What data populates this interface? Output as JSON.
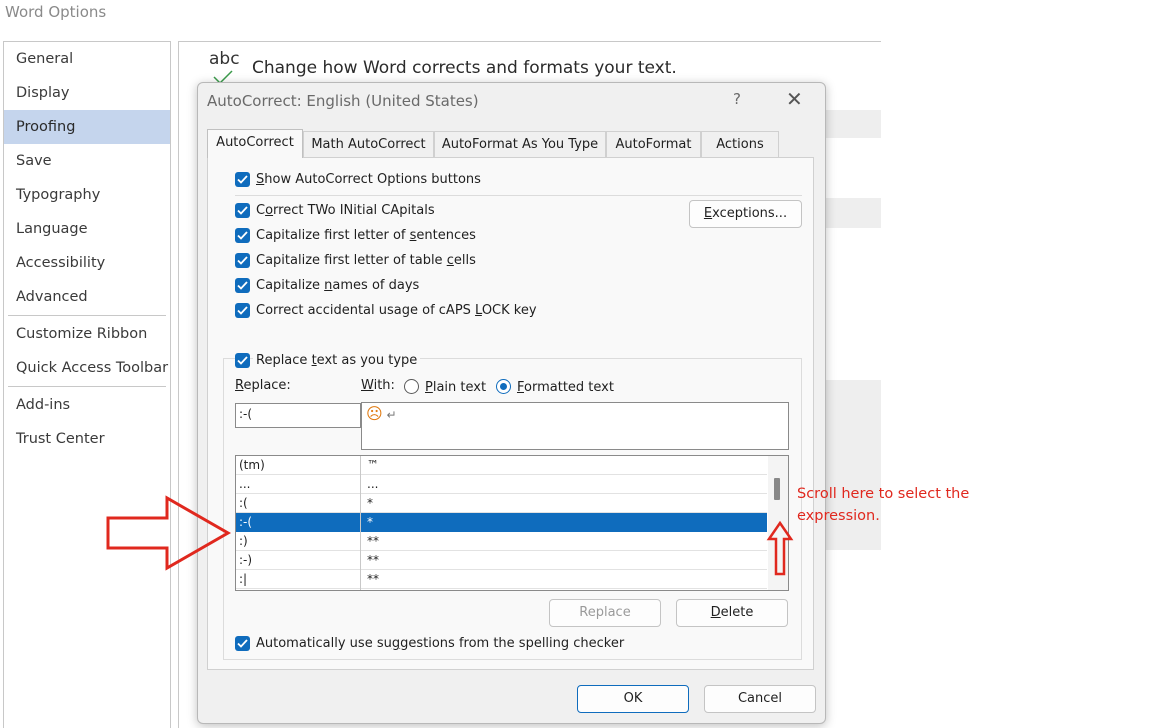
{
  "window": {
    "title": "Word Options"
  },
  "sidebar": {
    "items": [
      {
        "label": "General"
      },
      {
        "label": "Display"
      },
      {
        "label": "Proofing",
        "selected": true
      },
      {
        "label": "Save"
      },
      {
        "label": "Typography"
      },
      {
        "label": "Language"
      },
      {
        "label": "Accessibility"
      },
      {
        "label": "Advanced"
      },
      {
        "label": "Customize Ribbon"
      },
      {
        "label": "Quick Access Toolbar"
      },
      {
        "label": "Add-ins"
      },
      {
        "label": "Trust Center"
      }
    ]
  },
  "main": {
    "icon_text": "abc",
    "heading": "Change how Word corrects and formats your text."
  },
  "dialog": {
    "title": "AutoCorrect: English (United States)",
    "help": "?",
    "close": "✕",
    "tabs": [
      {
        "label": "AutoCorrect",
        "active": true
      },
      {
        "label": "Math AutoCorrect"
      },
      {
        "label": "AutoFormat As You Type"
      },
      {
        "label": "AutoFormat"
      },
      {
        "label": "Actions"
      }
    ],
    "show_options": {
      "pre": "",
      "ul": "S",
      "post": "how AutoCorrect Options buttons",
      "checked": true
    },
    "options": [
      {
        "pre": "C",
        "ul": "o",
        "post": "rrect TWo INitial CApitals",
        "checked": true
      },
      {
        "pre": "Capitalize first letter of ",
        "ul": "s",
        "post": "entences",
        "checked": true
      },
      {
        "pre": "Capitalize first letter of table ",
        "ul": "c",
        "post": "ells",
        "checked": true
      },
      {
        "pre": "Capitalize ",
        "ul": "n",
        "post": "ames of days",
        "checked": true
      },
      {
        "pre": "Correct accidental usage of cAPS ",
        "ul": "L",
        "post": "OCK key",
        "checked": true
      }
    ],
    "exceptions_button": {
      "pre": "",
      "ul": "E",
      "post": "xceptions..."
    },
    "replace_as_you_type": {
      "pre": "Replace ",
      "ul": "t",
      "post": "ext as you type",
      "checked": true
    },
    "replace_label": {
      "pre": "",
      "ul": "R",
      "post": "eplace:"
    },
    "with_label": {
      "pre": "",
      "ul": "W",
      "post": "ith:"
    },
    "radio_plain": {
      "pre": "",
      "ul": "P",
      "post": "lain text",
      "selected": false
    },
    "radio_formatted": {
      "pre": "",
      "ul": "F",
      "post": "ormatted text",
      "selected": true
    },
    "replace_value": ":-(",
    "with_value": "☹",
    "with_return_mark": "↵",
    "entries": [
      {
        "replace": "(tm)",
        "with": "™"
      },
      {
        "replace": "...",
        "with": "..."
      },
      {
        "replace": ":(",
        "with": "*"
      },
      {
        "replace": ":-(",
        "with": "*",
        "selected": true
      },
      {
        "replace": ":)",
        "with": "**"
      },
      {
        "replace": ":-)",
        "with": "**"
      },
      {
        "replace": ":|",
        "with": "**"
      }
    ],
    "replace_button": "Replace",
    "delete_button": {
      "pre": "",
      "ul": "D",
      "post": "elete"
    },
    "auto_suggest": {
      "pre": "Automatically use su",
      "ul": "g",
      "post": "gestions from the spelling checker",
      "checked": true
    },
    "ok_button": "OK",
    "cancel_button": "Cancel"
  },
  "annotation": {
    "text_line1": "Scroll here to select the",
    "text_line2": "expression.",
    "color": "#e0281e"
  },
  "colors": {
    "accent": "#0f6cbd",
    "sidebar_selected": "#c5d5ed",
    "dialog_bg": "#f0f0f0"
  }
}
